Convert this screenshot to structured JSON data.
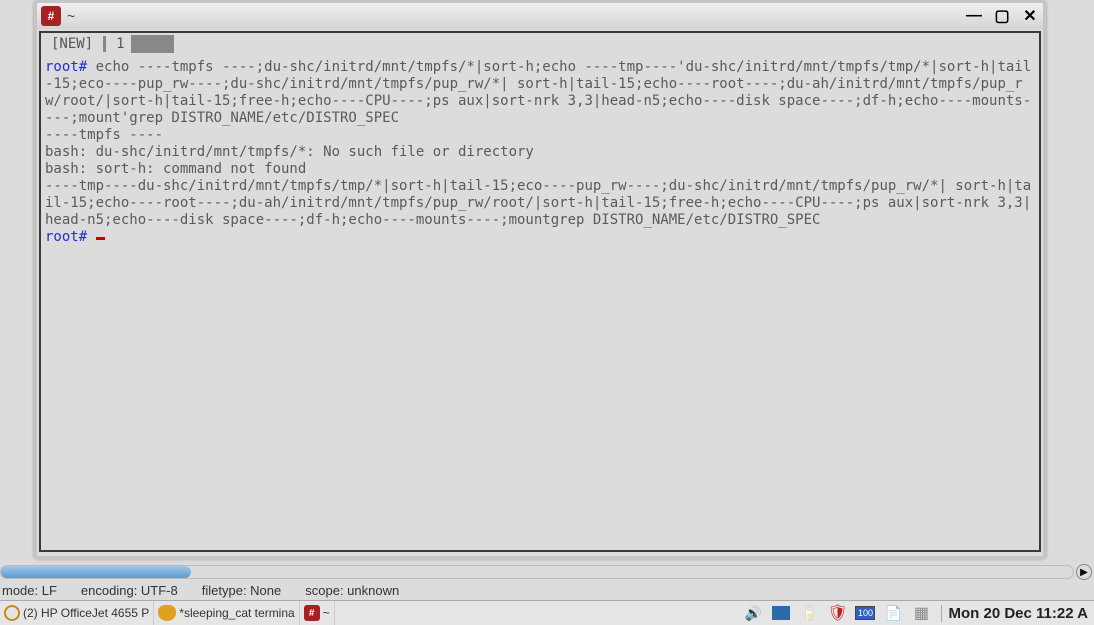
{
  "window": {
    "title": "~",
    "controls": {
      "min": "—",
      "max": "▢",
      "close": "✕"
    }
  },
  "tabs": {
    "prefix": "[NEW]",
    "num": "1"
  },
  "terminal": {
    "prompt": "root#",
    "line1": " echo ----tmpfs ----;du-shc/initrd/mnt/tmpfs/*|sort-h;echo ----tmp----'du-shc/initrd/mnt/tmpfs/tmp/*|sort-h|tail-15;eco----pup_rw----;du-shc/initrd/mnt/tmpfs/pup_rw/*| sort-h|tail-15;echo----root----;du-ah/initrd/mnt/tmpfs/pup_rw/root/|sort-h|tail-15;free-h;echo----CPU----;ps aux|sort-nrk 3,3|head-n5;echo----disk space----;df-h;echo----mounts----;mount'grep DISTRO_NAME/etc/DISTRO_SPEC",
    "out1": "----tmpfs ----",
    "out2": "bash: du-shc/initrd/mnt/tmpfs/*: No such file or directory",
    "out3": "bash: sort-h: command not found",
    "out4": "----tmp----du-shc/initrd/mnt/tmpfs/tmp/*|sort-h|tail-15;eco----pup_rw----;du-shc/initrd/mnt/tmpfs/pup_rw/*| sort-h|tail-15;echo----root----;du-ah/initrd/mnt/tmpfs/pup_rw/root/|sort-h|tail-15;free-h;echo----CPU----;ps aux|sort-nrk 3,3|head-n5;echo----disk space----;df-h;echo----mounts----;mountgrep DISTRO_NAME/etc/DISTRO_SPEC",
    "prompt2": "root#"
  },
  "status": {
    "mode": "mode: LF",
    "encoding": "encoding: UTF-8",
    "filetype": "filetype: None",
    "scope": "scope: unknown"
  },
  "taskbar": {
    "item1": "(2) HP OfficeJet 4655 P",
    "item2": "*sleeping_cat termina",
    "item3": "~",
    "battery": "100",
    "clock": "Mon 20 Dec 11:22 A"
  }
}
